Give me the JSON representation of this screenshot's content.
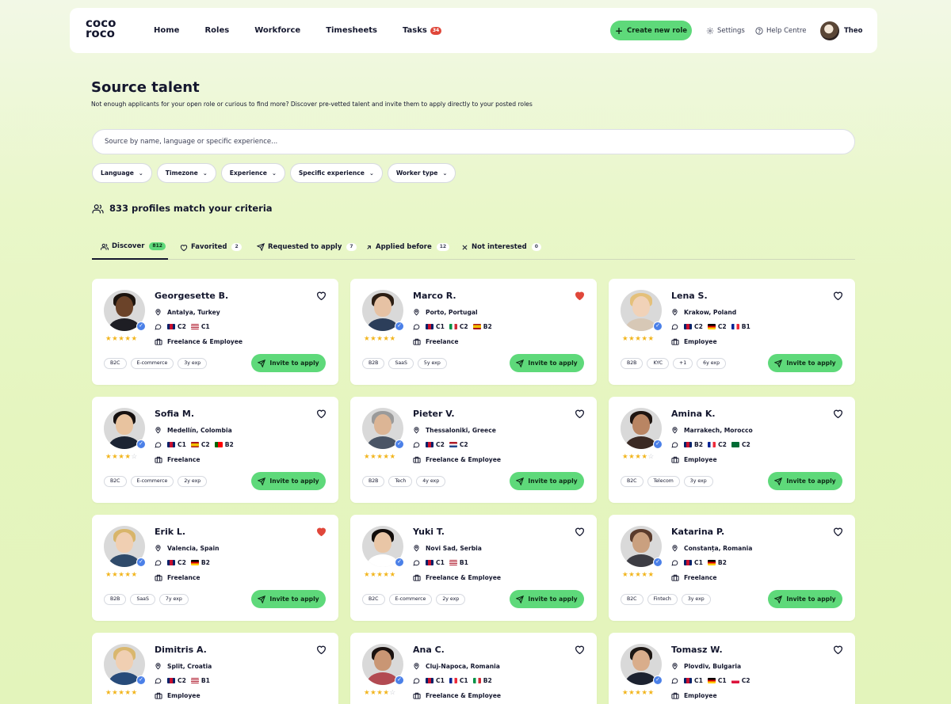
{
  "logo": {
    "line1": "coco",
    "line2": "roco"
  },
  "nav": {
    "links": [
      "Home",
      "Roles",
      "Workforce",
      "Timesheets",
      "Tasks"
    ],
    "tasks_badge": "34",
    "create_label": "Create new role",
    "settings_label": "Settings",
    "help_label": "Help Centre",
    "user_name": "Theo"
  },
  "header": {
    "title": "Source talent",
    "subtitle": "Not enough applicants for your open role or curious to find more? Discover pre-vetted talent and invite them to apply directly to your posted roles"
  },
  "search": {
    "placeholder": "Source by name, language or specific experience..."
  },
  "filters": [
    "Language",
    "Timezone",
    "Experience",
    "Specific experience",
    "Worker type"
  ],
  "results": {
    "count_text": "833 profiles match your criteria"
  },
  "tabs": [
    {
      "label": "Discover",
      "count": "812"
    },
    {
      "label": "Favorited",
      "count": "2"
    },
    {
      "label": "Requested to apply",
      "count": "7"
    },
    {
      "label": "Applied before",
      "count": "12"
    },
    {
      "label": "Not interested",
      "count": "0"
    }
  ],
  "invite_label": "Invite to apply",
  "colors": {
    "accent": "#5ed97a",
    "heart_active": "#e0473a",
    "verified": "#4b80e8",
    "star": "#f2b51d"
  },
  "profiles": [
    {
      "name": "Georgesette B.",
      "location": "Antalya, Turkey",
      "languages": [
        {
          "flag": "gb",
          "level": "C2"
        },
        {
          "flag": "us",
          "level": "C1"
        }
      ],
      "worker_type": "Freelance & Employee",
      "rating": 5,
      "favorited": false,
      "tags": [
        "B2C",
        "E-commerce",
        "3y exp"
      ]
    },
    {
      "name": "Marco R.",
      "location": "Porto, Portugal",
      "languages": [
        {
          "flag": "gb",
          "level": "C1"
        },
        {
          "flag": "it",
          "level": "C2"
        },
        {
          "flag": "es",
          "level": "B2"
        }
      ],
      "worker_type": "Freelance",
      "rating": 5,
      "favorited": true,
      "tags": [
        "B2B",
        "SaaS",
        "5y exp"
      ]
    },
    {
      "name": "Lena S.",
      "location": "Krakow, Poland",
      "languages": [
        {
          "flag": "gb",
          "level": "C2"
        },
        {
          "flag": "de",
          "level": "C2"
        },
        {
          "flag": "fr",
          "level": "B1"
        }
      ],
      "worker_type": "Employee",
      "rating": 5,
      "favorited": false,
      "tags": [
        "B2B",
        "KYC",
        "+1",
        "6y exp"
      ]
    },
    {
      "name": "Sofia M.",
      "location": "Medellín, Colombia",
      "languages": [
        {
          "flag": "gb",
          "level": "C1"
        },
        {
          "flag": "es",
          "level": "C2"
        },
        {
          "flag": "pt",
          "level": "B2"
        }
      ],
      "worker_type": "Freelance",
      "rating": 4,
      "favorited": false,
      "tags": [
        "B2C",
        "E-commerce",
        "2y exp"
      ]
    },
    {
      "name": "Pieter V.",
      "location": "Thessaloniki, Greece",
      "languages": [
        {
          "flag": "gb",
          "level": "C2"
        },
        {
          "flag": "nl",
          "level": "C2"
        }
      ],
      "worker_type": "Freelance & Employee",
      "rating": 5,
      "favorited": false,
      "tags": [
        "B2B",
        "Tech",
        "4y exp"
      ]
    },
    {
      "name": "Amina K.",
      "location": "Marrakech, Morocco",
      "languages": [
        {
          "flag": "gb",
          "level": "B2"
        },
        {
          "flag": "fr",
          "level": "C2"
        },
        {
          "flag": "sa",
          "level": "C2"
        }
      ],
      "worker_type": "Employee",
      "rating": 4,
      "favorited": false,
      "tags": [
        "B2C",
        "Telecom",
        "3y exp"
      ]
    },
    {
      "name": "Erik L.",
      "location": "Valencia, Spain",
      "languages": [
        {
          "flag": "gb",
          "level": "C2"
        },
        {
          "flag": "de",
          "level": "B2"
        }
      ],
      "worker_type": "Freelance",
      "rating": 5,
      "favorited": true,
      "tags": [
        "B2B",
        "SaaS",
        "7y exp"
      ]
    },
    {
      "name": "Yuki T.",
      "location": "Novi Sad, Serbia",
      "languages": [
        {
          "flag": "gb",
          "level": "C1"
        },
        {
          "flag": "us",
          "level": "B1"
        }
      ],
      "worker_type": "Freelance & Employee",
      "rating": 5,
      "favorited": false,
      "tags": [
        "B2C",
        "E-commerce",
        "2y exp"
      ]
    },
    {
      "name": "Katarina P.",
      "location": "Constanța, Romania",
      "languages": [
        {
          "flag": "gb",
          "level": "C1"
        },
        {
          "flag": "de",
          "level": "B2"
        }
      ],
      "worker_type": "Freelance",
      "rating": 5,
      "favorited": false,
      "tags": [
        "B2C",
        "Fintech",
        "3y exp"
      ]
    },
    {
      "name": "Dimitris A.",
      "location": "Split, Croatia",
      "languages": [
        {
          "flag": "gb",
          "level": "C2"
        },
        {
          "flag": "us",
          "level": "B1"
        }
      ],
      "worker_type": "Employee",
      "rating": 5,
      "favorited": false,
      "tags": []
    },
    {
      "name": "Ana C.",
      "location": "Cluj-Napoca, Romania",
      "languages": [
        {
          "flag": "gb",
          "level": "C1"
        },
        {
          "flag": "fr",
          "level": "C1"
        },
        {
          "flag": "it",
          "level": "B2"
        }
      ],
      "worker_type": "Freelance & Employee",
      "rating": 4,
      "favorited": false,
      "tags": []
    },
    {
      "name": "Tomasz W.",
      "location": "Plovdiv, Bulgaria",
      "languages": [
        {
          "flag": "gb",
          "level": "C1"
        },
        {
          "flag": "de",
          "level": "C1"
        },
        {
          "flag": "pl",
          "level": "C2"
        }
      ],
      "worker_type": "Employee",
      "rating": 5,
      "favorited": false,
      "tags": []
    }
  ]
}
